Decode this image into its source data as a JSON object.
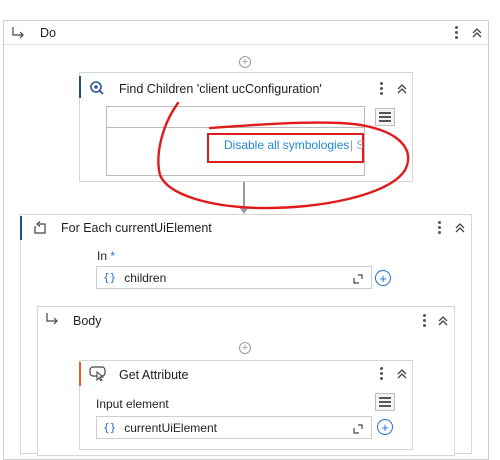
{
  "do_sequence": {
    "title": "Do"
  },
  "find_children": {
    "title": "Find Children 'client  ucConfiguration'",
    "preview_link": "Disable all symbologies",
    "preview_link_cut": "| S"
  },
  "for_each": {
    "title": "For Each currentUiElement",
    "in_label": "In",
    "in_required": "*",
    "in_value": "children"
  },
  "body": {
    "title": "Body"
  },
  "get_attribute": {
    "title": "Get Attribute",
    "input_label": "Input element",
    "input_value": "currentUiElement"
  },
  "icons": {
    "variable": "{}",
    "add": "+",
    "kebab": "more-vert-icon",
    "collapse": "double-chevron-up-icon",
    "sequence": "sequence-arrow-icon",
    "loop": "loop-icon",
    "search": "search-target-icon",
    "hover": "hover-attribute-icon"
  },
  "colors": {
    "accent_blue": "#1a4f8a",
    "accent_orange": "#f05a22",
    "link": "#1e88d2",
    "annotation_red": "#e01b1b"
  }
}
